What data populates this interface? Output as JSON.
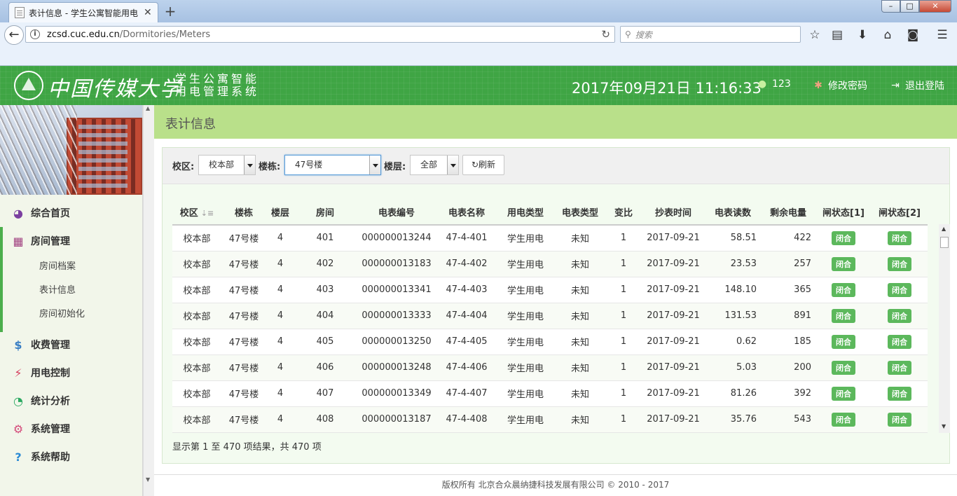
{
  "browser": {
    "tab_title": "表计信息 - 学生公寓智能用电",
    "tab_close": "✕",
    "new_tab": "+",
    "url_host": "zcsd.cuc.edu.cn",
    "url_path": "/Dormitories/Meters",
    "search_placeholder": "搜索"
  },
  "header": {
    "school_name": "中国传媒大学",
    "system_name": "学生公寓智能用电管理系统",
    "datetime": "2017年09月21日 11:16:33",
    "user": "123",
    "change_password": "修改密码",
    "logout": "退出登陆"
  },
  "sidebar": {
    "items": [
      {
        "label": "综合首页",
        "icon": "dashboard-icon"
      },
      {
        "label": "房间管理",
        "icon": "building-icon"
      },
      {
        "label": "收费管理",
        "icon": "dollar-icon"
      },
      {
        "label": "用电控制",
        "icon": "plug-icon"
      },
      {
        "label": "统计分析",
        "icon": "pie-chart-icon"
      },
      {
        "label": "系统管理",
        "icon": "gears-icon"
      },
      {
        "label": "系统帮助",
        "icon": "help-icon"
      }
    ],
    "submenu": [
      "房间档案",
      "表计信息",
      "房间初始化"
    ]
  },
  "page": {
    "title": "表计信息"
  },
  "filters": {
    "campus_label": "校区:",
    "campus_value": "校本部",
    "building_label": "楼栋:",
    "building_value": "47号楼",
    "floor_label": "楼层:",
    "floor_value": "全部",
    "refresh_label": "刷新"
  },
  "table": {
    "columns": [
      "校区",
      "楼栋",
      "楼层",
      "房间",
      "电表编号",
      "电表名称",
      "用电类型",
      "电表类型",
      "变比",
      "抄表时间",
      "电表读数",
      "剩余电量",
      "闸状态[1]",
      "闸状态[2]"
    ],
    "rows": [
      [
        "校本部",
        "47号楼",
        "4",
        "401",
        "000000013244",
        "47-4-401",
        "学生用电",
        "未知",
        "1",
        "2017-09-21",
        "58.51",
        "422",
        "闭合",
        "闭合"
      ],
      [
        "校本部",
        "47号楼",
        "4",
        "402",
        "000000013183",
        "47-4-402",
        "学生用电",
        "未知",
        "1",
        "2017-09-21",
        "23.53",
        "257",
        "闭合",
        "闭合"
      ],
      [
        "校本部",
        "47号楼",
        "4",
        "403",
        "000000013341",
        "47-4-403",
        "学生用电",
        "未知",
        "1",
        "2017-09-21",
        "148.10",
        "365",
        "闭合",
        "闭合"
      ],
      [
        "校本部",
        "47号楼",
        "4",
        "404",
        "000000013333",
        "47-4-404",
        "学生用电",
        "未知",
        "1",
        "2017-09-21",
        "131.53",
        "891",
        "闭合",
        "闭合"
      ],
      [
        "校本部",
        "47号楼",
        "4",
        "405",
        "000000013250",
        "47-4-405",
        "学生用电",
        "未知",
        "1",
        "2017-09-21",
        "0.62",
        "185",
        "闭合",
        "闭合"
      ],
      [
        "校本部",
        "47号楼",
        "4",
        "406",
        "000000013248",
        "47-4-406",
        "学生用电",
        "未知",
        "1",
        "2017-09-21",
        "5.03",
        "200",
        "闭合",
        "闭合"
      ],
      [
        "校本部",
        "47号楼",
        "4",
        "407",
        "000000013349",
        "47-4-407",
        "学生用电",
        "未知",
        "1",
        "2017-09-21",
        "81.26",
        "392",
        "闭合",
        "闭合"
      ],
      [
        "校本部",
        "47号楼",
        "4",
        "408",
        "000000013187",
        "47-4-408",
        "学生用电",
        "未知",
        "1",
        "2017-09-21",
        "35.76",
        "543",
        "闭合",
        "闭合"
      ]
    ],
    "info": "显示第 1 至 470 项结果，共 470 项"
  },
  "footer": {
    "copyright": "版权所有 北京合众晨纳捷科技发展有限公司 © 2010 - 2017"
  },
  "colors": {
    "header_green": "#3fa544",
    "page_header_green": "#b9e08a",
    "badge_green": "#5cb85c"
  }
}
